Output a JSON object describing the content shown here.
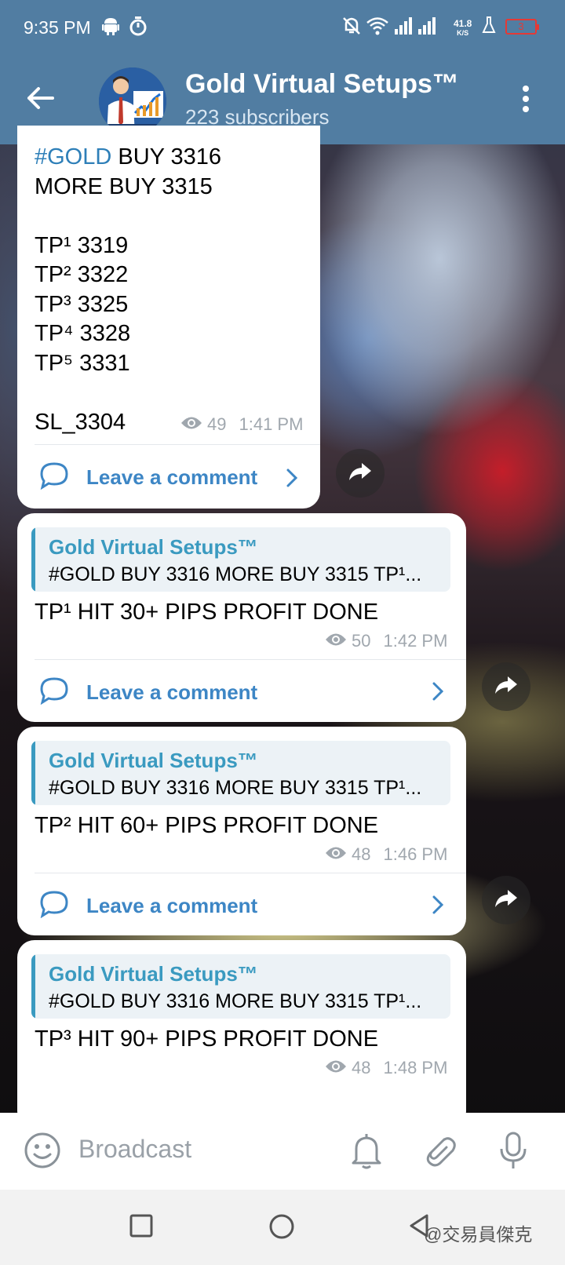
{
  "status_bar": {
    "time": "9:35 PM",
    "net_speed_value": "41.8",
    "net_speed_unit": "K/S",
    "battery": "3"
  },
  "header": {
    "title": "Gold Virtual Setups™",
    "subtitle": "223 subscribers"
  },
  "messages": [
    {
      "hashtag": "#GOLD",
      "lines": [
        " BUY 3316",
        "MORE BUY 3315",
        "",
        "TP¹ 3319",
        "TP² 3322",
        "TP³ 3325",
        "TP⁴ 3328",
        "TP⁵ 3331",
        "",
        "SL_3304"
      ],
      "views": "49",
      "time": "1:41 PM",
      "comment_label": "Leave a comment"
    },
    {
      "reply_name": "Gold Virtual Setups™",
      "reply_text": "#GOLD BUY 3316 MORE BUY 3315  TP¹...",
      "text": "TP¹ HIT 30+ PIPS PROFIT DONE",
      "views": "50",
      "time": "1:42 PM",
      "comment_label": "Leave a comment"
    },
    {
      "reply_name": "Gold Virtual Setups™",
      "reply_text": "#GOLD BUY 3316 MORE BUY 3315  TP¹...",
      "text": "TP² HIT 60+ PIPS PROFIT DONE",
      "views": "48",
      "time": "1:46 PM",
      "comment_label": "Leave a comment"
    },
    {
      "reply_name": "Gold Virtual Setups™",
      "reply_text": "#GOLD BUY 3316 MORE BUY 3315  TP¹...",
      "text": "TP³ HIT 90+ PIPS PROFIT DONE",
      "views": "48",
      "time": "1:48 PM"
    }
  ],
  "input_bar": {
    "placeholder": "Broadcast"
  },
  "watermark": "@交易員傑克",
  "colors": {
    "header": "#517da2",
    "link": "#3d86c5",
    "reply_accent": "#3a9ac0"
  }
}
